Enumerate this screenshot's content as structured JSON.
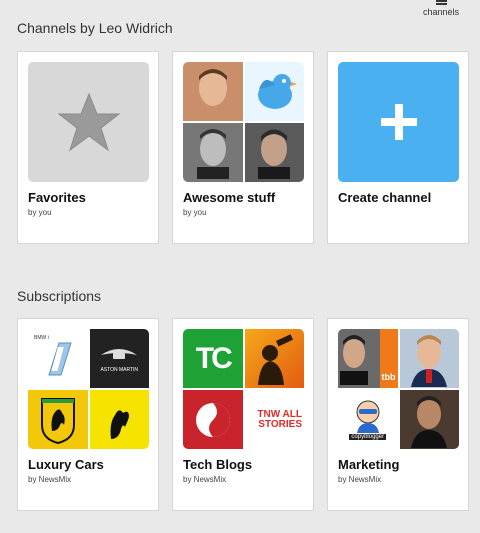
{
  "header": {
    "channels_label": "channels",
    "section_title": "Channels by Leo Widrich"
  },
  "channels": [
    {
      "title": "Favorites",
      "subtitle": "by you"
    },
    {
      "title": "Awesome stuff",
      "subtitle": "by you"
    },
    {
      "title": "Create channel",
      "subtitle": ""
    }
  ],
  "subscriptions": {
    "section_title": "Subscriptions",
    "items": [
      {
        "title": "Luxury Cars",
        "subtitle": "by NewsMix",
        "tile_labels": [
          "BMW i",
          "",
          "ASTON MARTIN",
          ""
        ]
      },
      {
        "title": "Tech Blogs",
        "subtitle": "by NewsMix",
        "tile_labels": [
          "TC",
          "",
          "",
          "TNW ALL STORIES"
        ]
      },
      {
        "title": "Marketing",
        "subtitle": "by NewsMix",
        "tile_labels": [
          "tbb",
          "",
          "copyblogger",
          ""
        ]
      }
    ]
  },
  "colors": {
    "create_blue": "#4ab0ef",
    "tc_green": "#1ea236",
    "tnw_red": "#e32b26",
    "favorites_gray": "#d8d8d8"
  }
}
